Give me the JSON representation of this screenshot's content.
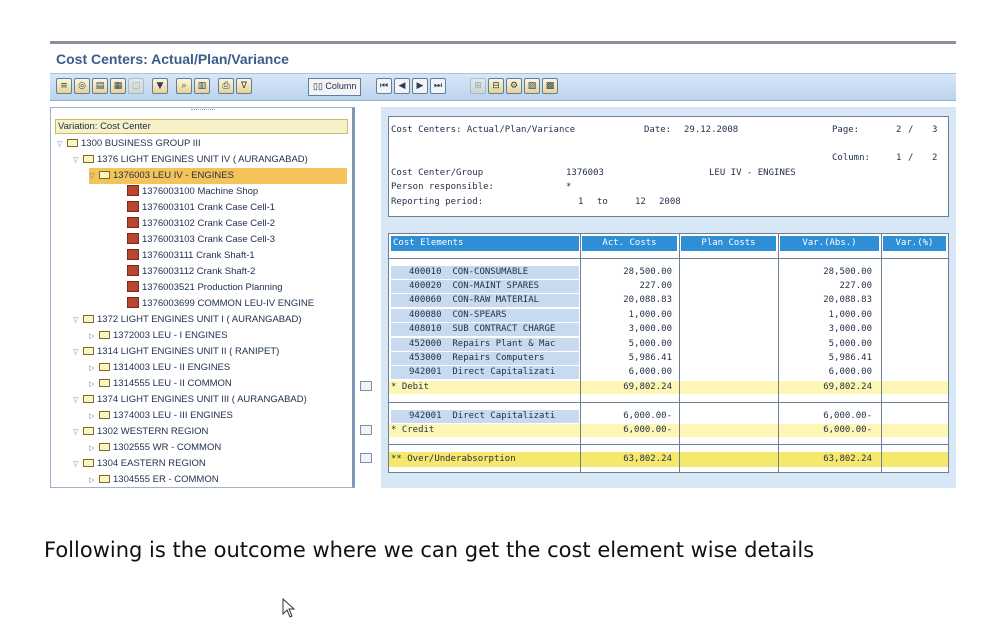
{
  "window": {
    "title": "Cost Centers: Actual/Plan/Variance"
  },
  "toolbar": {
    "column_label": "Column",
    "icons": [
      "hierarchy-icon",
      "find-icon",
      "layout-icon",
      "export-icon",
      "list-icon",
      "delete-icon",
      "search-icon",
      "grid-icon",
      "print-icon",
      "filter-icon",
      "first-page-icon",
      "previous-page-icon",
      "next-page-icon",
      "last-page-icon",
      "expand-icon",
      "tree-icon",
      "settings-icon",
      "graphic-icon"
    ]
  },
  "tree": {
    "variation": "Variation: Cost Center",
    "rows": [
      {
        "label": "1300 BUSINESS GROUP III"
      },
      {
        "label": "1376 LIGHT ENGINES UNIT IV ( AURANGABAD)"
      },
      {
        "label": "1376003 LEU IV - ENGINES"
      },
      {
        "label": "1376003100 Machine Shop"
      },
      {
        "label": "1376003101 Crank Case Cell-1"
      },
      {
        "label": "1376003102 Crank Case Cell-2"
      },
      {
        "label": "1376003103 Crank Case Cell-3"
      },
      {
        "label": "1376003111 Crank Shaft-1"
      },
      {
        "label": "1376003112 Crank Shaft-2"
      },
      {
        "label": "1376003521 Production Planning"
      },
      {
        "label": "1376003699 COMMON LEU-IV ENGINE"
      },
      {
        "label": "1372 LIGHT ENGINES UNIT I ( AURANGABAD)"
      },
      {
        "label": "1372003 LEU - I ENGINES"
      },
      {
        "label": "1314 LIGHT ENGINES UNIT II ( RANIPET)"
      },
      {
        "label": "1314003 LEU - II ENGINES"
      },
      {
        "label": "1314555 LEU - II COMMON"
      },
      {
        "label": "1374 LIGHT ENGINES UNIT III ( AURANGABAD)"
      },
      {
        "label": "1374003 LEU - III ENGINES"
      },
      {
        "label": "1302 WESTERN REGION"
      },
      {
        "label": "1302555 WR - COMMON"
      },
      {
        "label": "1304 EASTERN REGION"
      },
      {
        "label": "1304555 ER - COMMON"
      }
    ]
  },
  "report": {
    "title": "Cost Centers: Actual/Plan/Variance",
    "date_label": "Date:",
    "date": "29.12.2008",
    "page_label": "Page:",
    "page_current": "2",
    "page_sep": "/",
    "page_total": "3",
    "column_label": "Column:",
    "column_current": "1",
    "column_sep": "/",
    "column_total": "2",
    "cc_group_label": "Cost Center/Group",
    "cc_group_value": "1376003",
    "cc_group_desc": "LEU IV - ENGINES",
    "person_label": "Person responsible:",
    "person_value": "*",
    "period_label": "Reporting period:",
    "period_from": "1",
    "period_to_word": "to",
    "period_to": "12",
    "period_year": "2008"
  },
  "grid": {
    "headers": [
      "Cost Elements",
      "Act. Costs",
      "Plan Costs",
      "Var.(Abs.)",
      "Var.(%)"
    ],
    "rows": [
      {
        "code": "400010",
        "name": "CON-CONSUMABLE",
        "act": "28,500.00",
        "var": "28,500.00"
      },
      {
        "code": "400020",
        "name": "CON-MAINT SPARES",
        "act": "227.00",
        "var": "227.00"
      },
      {
        "code": "400060",
        "name": "CON-RAW MATERIAL",
        "act": "20,088.83",
        "var": "20,088.83"
      },
      {
        "code": "400080",
        "name": "CON-SPEARS",
        "act": "1,000.00",
        "var": "1,000.00"
      },
      {
        "code": "408010",
        "name": "SUB CONTRACT CHARGE",
        "act": "3,000.00",
        "var": "3,000.00"
      },
      {
        "code": "452000",
        "name": "Repairs Plant & Mac",
        "act": "5,000.00",
        "var": "5,000.00"
      },
      {
        "code": "453000",
        "name": "Repairs Computers",
        "act": "5,986.41",
        "var": "5,986.41"
      },
      {
        "code": "942001",
        "name": "Direct Capitalizati",
        "act": "6,000.00",
        "var": "6,000.00"
      }
    ],
    "debit": {
      "label": "* Debit",
      "act": "69,802.24",
      "var": "69,802.24"
    },
    "credit_row": {
      "code": "942001",
      "name": "Direct Capitalizati",
      "act": "6,000.00-",
      "var": "6,000.00-"
    },
    "credit": {
      "label": "* Credit",
      "act": "6,000.00-",
      "var": "6,000.00-"
    },
    "over": {
      "label": "** Over/Underabsorption",
      "act": "63,802.24",
      "var": "63,802.24"
    }
  },
  "caption": "Following is the outcome where we can get the cost element wise details"
}
